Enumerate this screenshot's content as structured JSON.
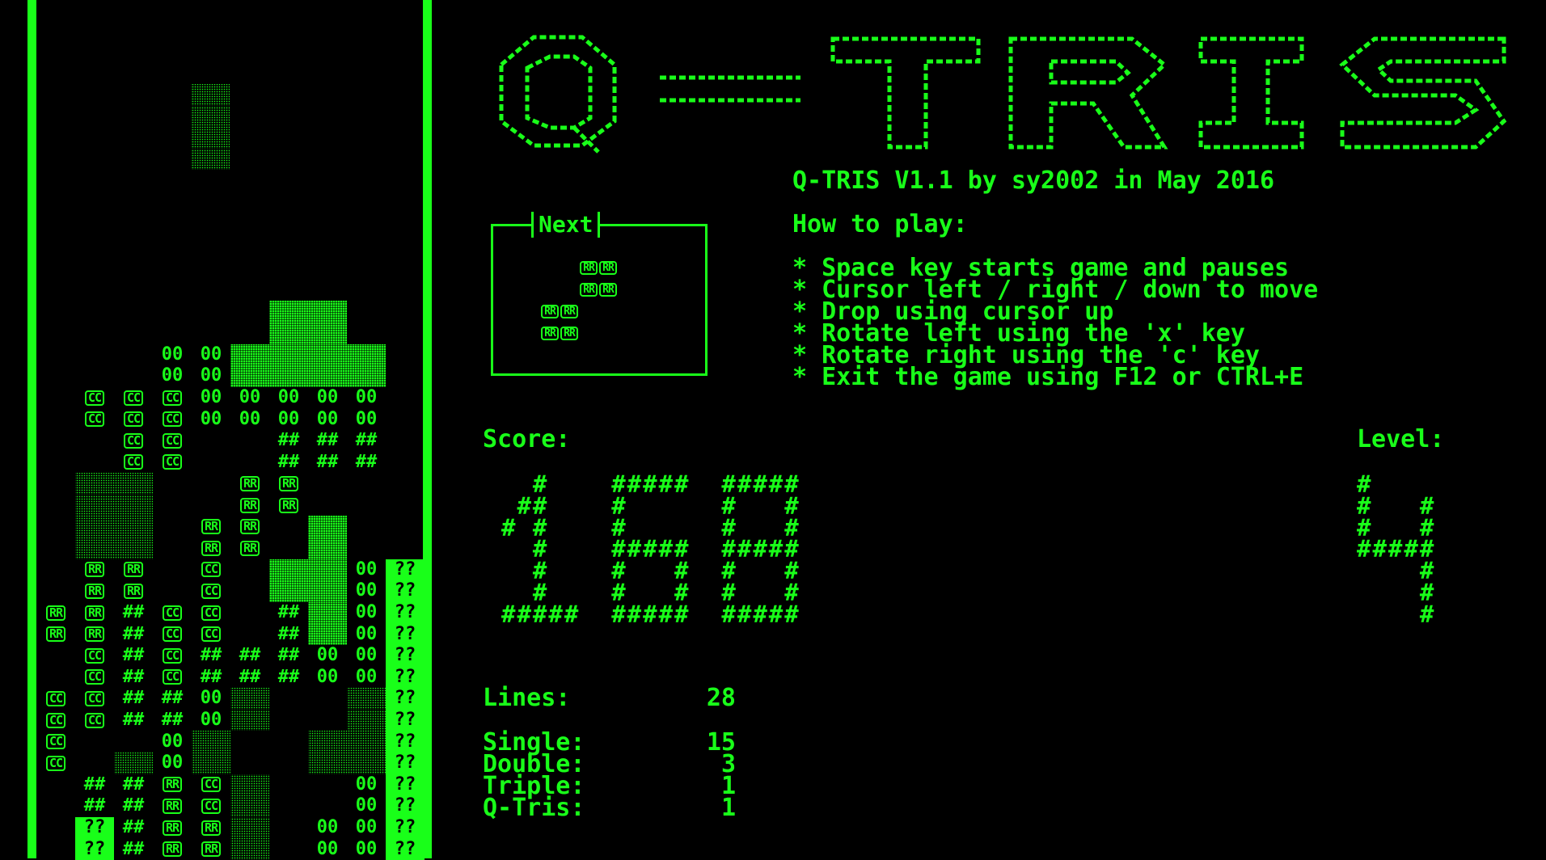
{
  "game": {
    "title": "Q-TRIS",
    "credit": "Q-TRIS V1.1 by sy2002 in May 2016",
    "howto_heading": "How to play:",
    "instructions": [
      "* Space key starts game and pauses",
      "* Cursor left / right / down to move",
      "* Drop using cursor up",
      "* Rotate left using the 'x' key",
      "* Rotate right using the 'c' key",
      "* Exit the game using F12 or CTRL+E"
    ],
    "next_label": "Next",
    "score_label": "Score:",
    "score_value": "168",
    "level_label": "Level:",
    "level_value": "4",
    "stats": [
      {
        "label": "Lines:",
        "value": "28"
      },
      {
        "label": "Single:",
        "value": "15"
      },
      {
        "label": "Double:",
        "value": "3"
      },
      {
        "label": "Triple:",
        "value": "1"
      },
      {
        "label": "Q-Tris:",
        "value": "1"
      }
    ]
  },
  "board": {
    "falling_piece": [
      [
        0,
        4
      ],
      [
        1,
        4
      ],
      [
        2,
        4
      ],
      [
        3,
        4
      ]
    ],
    "rows": [
      "          ",
      "          ",
      "          ",
      "          ",
      "          ",
      "          ",
      "          ",
      "          ",
      "          ",
      "          ",
      "          ",
      "          ",
      "          ",
      "          ",
      "      ss  ",
      "      ss  ",
      "   OOssSS ",
      "   OOSSss ",
      " CCCOOOOO #",
      " CCCOOOOO #",
      "  CC  ###  ",
      "  CC  ###  ",
      " dd  RR   ?",
      " dd  RR   ?",
      " dd RR s  ?",
      " dd RR s  ?",
      " RR C ssO?",
      " RR C ssO?",
      "RR#CC #sO?",
      "RR#CC #sO?",
      " C#C###OO?",
      " C#C###OO?",
      "CC##Od  d?",
      "CC##Od  d?",
      "C  Od  dd?",
      "C dOd  dd?",
      " ##RCd  O?",
      " ##RCd  O?",
      " ?#RRd OO?",
      " ?#RRd OO?"
    ]
  },
  "next_piece": {
    "rows": [
      "  RR",
      "  RR",
      "RR  ",
      "RR  "
    ]
  },
  "colors": {
    "phosphor": "#19ff19",
    "background": "#000000"
  }
}
